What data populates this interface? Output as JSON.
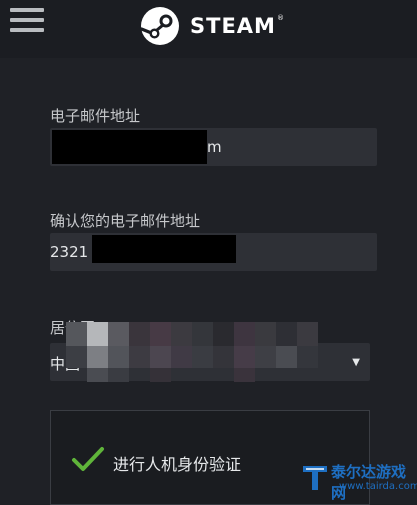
{
  "header": {
    "brand": "STEAM",
    "trademark": "®",
    "menu_icon": "hamburger-menu-icon",
    "logo_icon": "steam-logo-icon"
  },
  "form": {
    "email_label": "电子邮件地址",
    "email_value_suffix": "m",
    "confirm_email_label": "确认您的电子邮件地址",
    "confirm_email_value_prefix": "2321",
    "country_label": "居住国",
    "country_value": "中国",
    "country_chevron": "▼"
  },
  "captcha": {
    "label": "进行人机身份验证",
    "check_icon": "checkmark-icon",
    "check_color": "#5fb43a"
  },
  "watermark": {
    "title": "泰尔达游戏网",
    "url": "www.tairda.com",
    "color": "#1e6fc2"
  },
  "colors": {
    "background": "#1f2126",
    "field_background": "#2e3036",
    "text": "#dcdedf"
  }
}
